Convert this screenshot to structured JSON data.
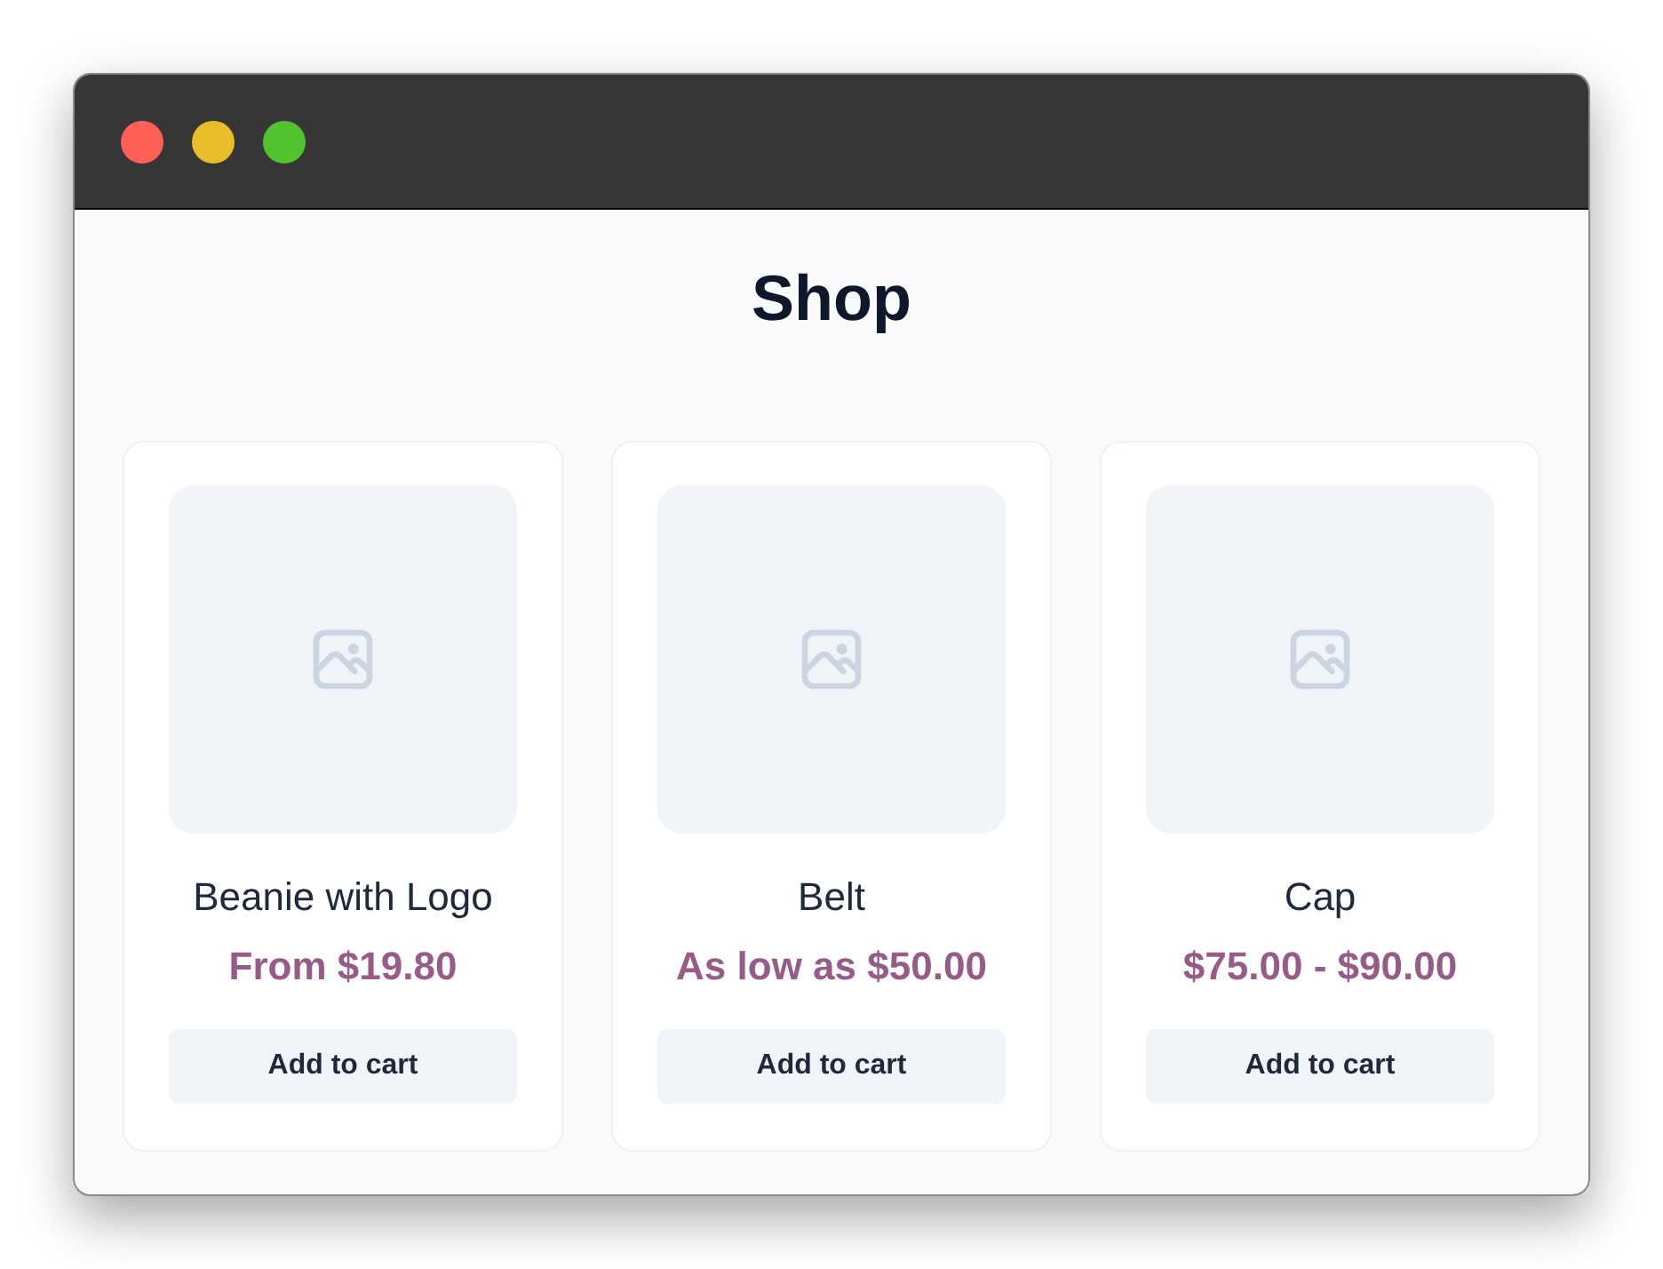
{
  "window": {
    "title_bar": {
      "buttons": [
        {
          "color": "#fe5f57"
        },
        {
          "color": "#e8bf2b"
        },
        {
          "color": "#52c22e"
        }
      ]
    }
  },
  "page": {
    "title": "Shop"
  },
  "products": [
    {
      "name": "Beanie with Logo",
      "price": "From $19.80",
      "button": "Add to cart"
    },
    {
      "name": "Belt",
      "price": "As low as $50.00",
      "button": "Add to cart"
    },
    {
      "name": "Cap",
      "price": "$75.00 - $90.00",
      "button": "Add to cart"
    }
  ]
}
